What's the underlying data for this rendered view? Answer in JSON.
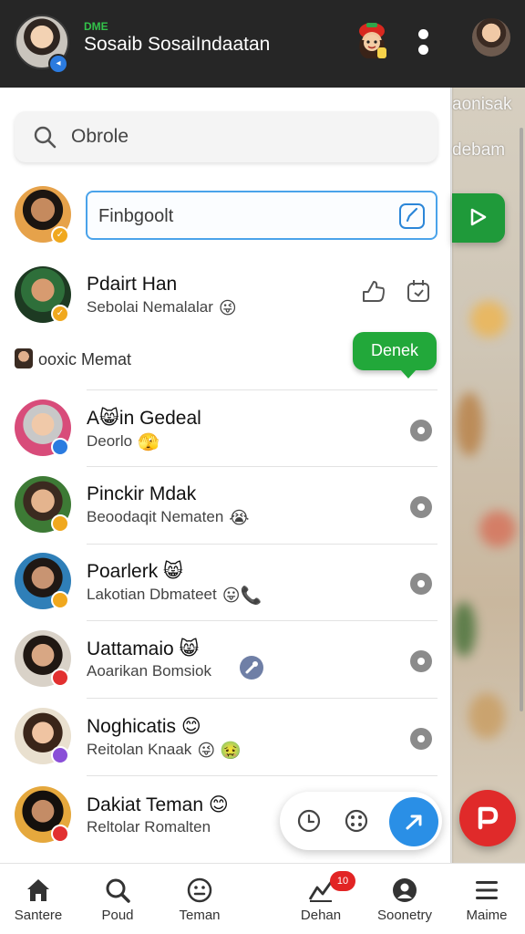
{
  "header": {
    "small_label": "DME",
    "title": "Sosaib SosaiIndaatan",
    "menu_icon": "kebab-icon"
  },
  "background": {
    "text_1": "aonisak",
    "text_2": "debam"
  },
  "search": {
    "placeholder": "Obrole"
  },
  "compose": {
    "placeholder": "Finbgoolt"
  },
  "pinned": {
    "name": "Pdairt Han",
    "message": "Sebolai Nemalalar",
    "emoji": "😜"
  },
  "section": {
    "label": "ooxic Memat",
    "action_label": "Denek"
  },
  "chats": [
    {
      "name": "A😸in Gedeal",
      "message": "Deorlo",
      "emoji": "🫣",
      "badge_color": "#2b7be0"
    },
    {
      "name": "Pinckir Mdak",
      "message": "Beoodaqit Nematen",
      "emoji": "😭",
      "badge_color": "#f0a81e"
    },
    {
      "name": "Poarlerk 😸",
      "message": "Lakotian Dbmateet",
      "emoji": "😛📞",
      "badge_color": "#f0a81e"
    },
    {
      "name": "Uattamaio 😸",
      "message": "Aoarikan Bomsiok",
      "emoji": "",
      "badge_color": "#e23030"
    },
    {
      "name": "Noghicatis 😊",
      "message": "Reitolan Knaak",
      "emoji": "😜 🤢",
      "badge_color": "#8a4fd8"
    },
    {
      "name": "Dakiat Teman 😊",
      "message": "Reltolar Romalten",
      "emoji": "",
      "badge_color": "#e23030"
    }
  ],
  "nav": [
    {
      "label": "Santere",
      "icon": "home-icon"
    },
    {
      "label": "Poud",
      "icon": "search-icon"
    },
    {
      "label": "Teman",
      "icon": "smiley-icon"
    },
    {
      "label": "Dehan",
      "icon": "chart-icon",
      "badge": "10"
    },
    {
      "label": "Soonetry",
      "icon": "profile-icon"
    },
    {
      "label": "Maime",
      "icon": "menu-icon"
    }
  ],
  "colors": {
    "header_bg": "#262626",
    "accent_green": "#22a83a",
    "accent_blue": "#2a8fe6",
    "fab_red": "#e02a2a"
  }
}
